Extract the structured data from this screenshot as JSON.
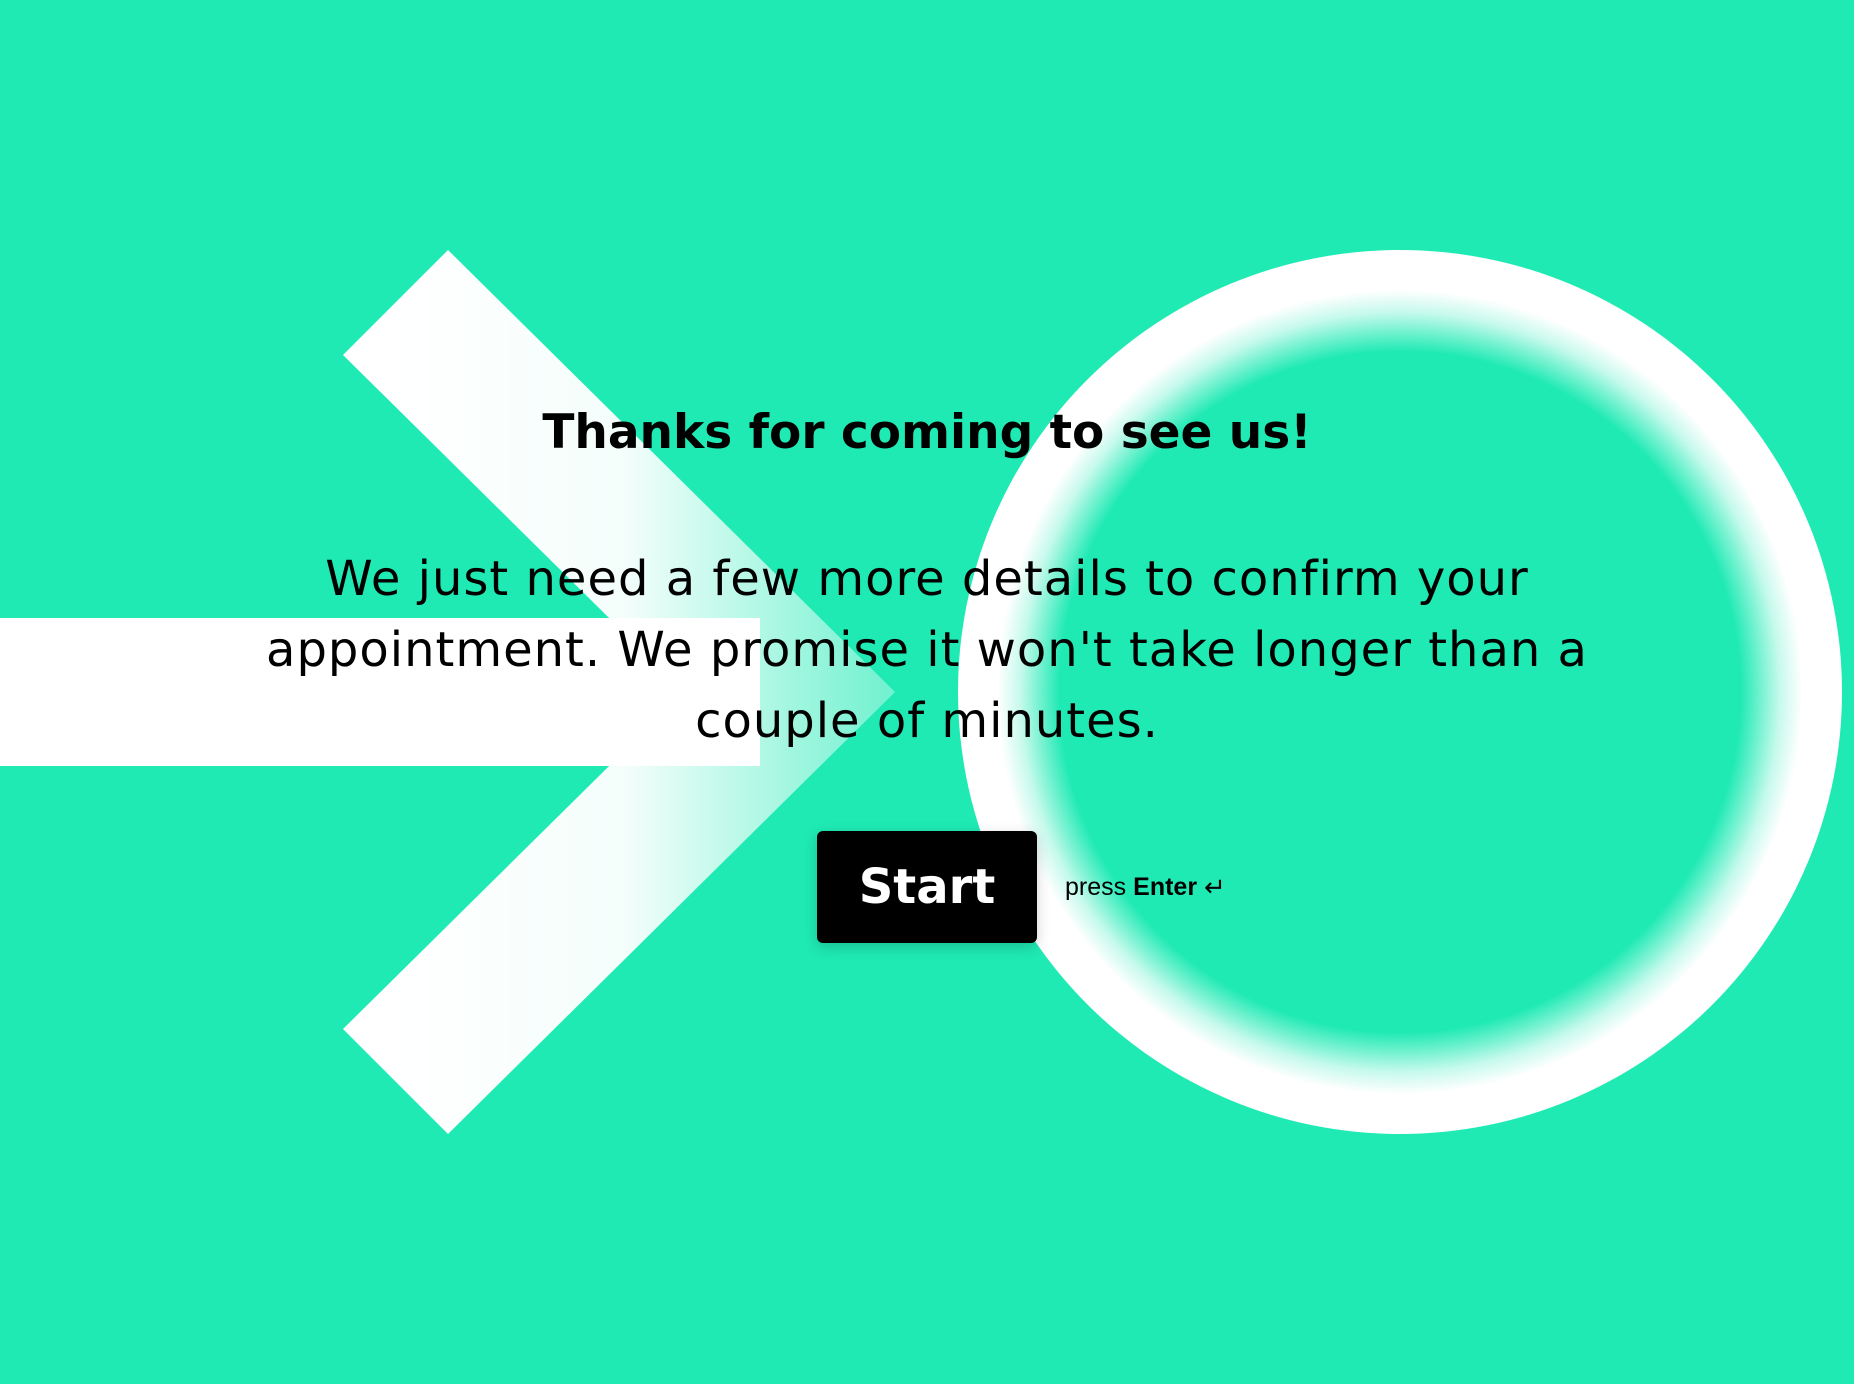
{
  "colors": {
    "background": "#1FEAB4",
    "graphic": "#FFFFFF",
    "button_bg": "#000000",
    "button_text": "#FFFFFF",
    "text": "#000000"
  },
  "welcome": {
    "title": "Thanks for coming to see us!",
    "description": "We just need a few more details to confirm your appointment. We promise it won't take longer than a couple of minutes.",
    "start_label": "Start",
    "hint_prefix": "press",
    "hint_key": "Enter",
    "hint_icon": "↵"
  },
  "icons": {
    "enter": "enter-key-icon",
    "background": "arrow-circle-logo"
  }
}
